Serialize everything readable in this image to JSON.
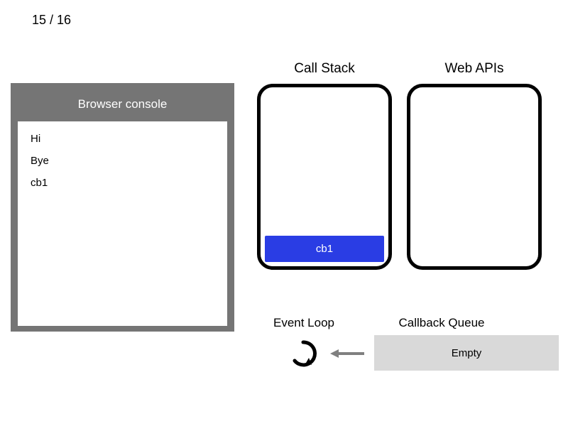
{
  "slide": {
    "current": 15,
    "total": 16,
    "display": "15 / 16"
  },
  "console": {
    "title": "Browser console",
    "lines": [
      "Hi",
      "Bye",
      "cb1"
    ]
  },
  "sections": {
    "call_stack_label": "Call Stack",
    "web_apis_label": "Web APIs",
    "event_loop_label": "Event Loop",
    "callback_queue_label": "Callback Queue"
  },
  "call_stack": {
    "frames": [
      "cb1"
    ]
  },
  "web_apis": {
    "items": []
  },
  "callback_queue": {
    "empty_label": "Empty",
    "items": []
  }
}
